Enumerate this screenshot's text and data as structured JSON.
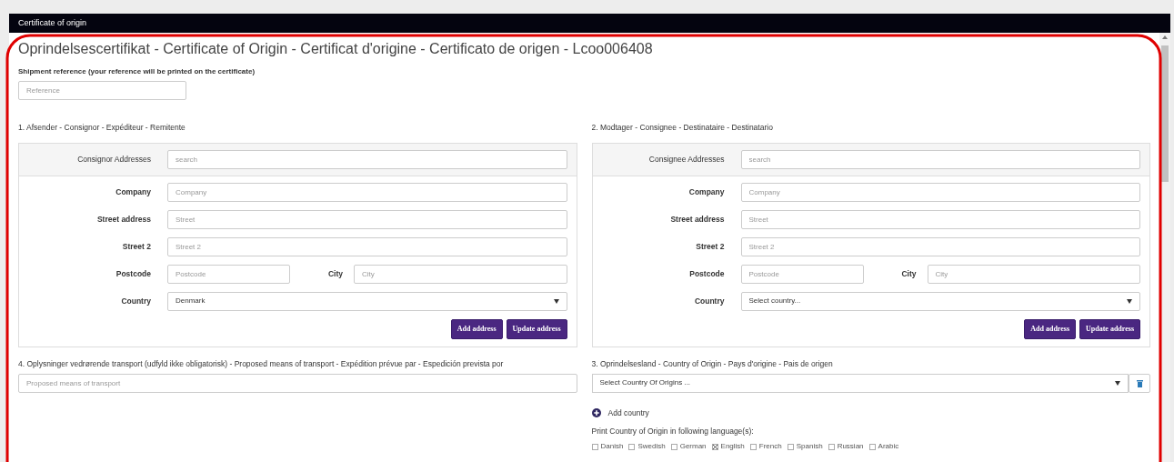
{
  "window": {
    "title": "Certificate of origin"
  },
  "heading": "Oprindelsescertifikat - Certificate of Origin - Certificat d'origine - Certificato de origen - Lcoo006408",
  "shipment_reference": {
    "label": "Shipment reference (your reference will be printed on the certificate)",
    "placeholder": "Reference"
  },
  "parties": [
    {
      "title": "1. Afsender - Consignor - Expéditeur - Remitente",
      "search": {
        "label": "Consignor Addresses",
        "placeholder": "search"
      },
      "fields": [
        {
          "kind": "text",
          "label": "Company",
          "placeholder": "Company"
        },
        {
          "kind": "text",
          "label": "Street address",
          "placeholder": "Street"
        },
        {
          "kind": "text",
          "label": "Street 2",
          "placeholder": "Street 2"
        },
        {
          "kind": "pair",
          "label": "Postcode",
          "placeholder": "Postcode",
          "label2": "City",
          "placeholder2": "City"
        },
        {
          "kind": "select",
          "label": "Country",
          "value": "Denmark"
        }
      ],
      "buttons": [
        "Add address",
        "Update address"
      ]
    },
    {
      "title": "2. Modtager - Consignee - Destinataire - Destinatario",
      "search": {
        "label": "Consignee Addresses",
        "placeholder": "search"
      },
      "fields": [
        {
          "kind": "text",
          "label": "Company",
          "placeholder": "Company"
        },
        {
          "kind": "text",
          "label": "Street address",
          "placeholder": "Street"
        },
        {
          "kind": "text",
          "label": "Street 2",
          "placeholder": "Street 2"
        },
        {
          "kind": "pair",
          "label": "Postcode",
          "placeholder": "Postcode",
          "label2": "City",
          "placeholder2": "City"
        },
        {
          "kind": "select",
          "label": "Country",
          "value": "Select country..."
        }
      ],
      "buttons": [
        "Add address",
        "Update address"
      ]
    }
  ],
  "transport": {
    "title": "4. Oplysninger vedrørende transport (udfyld ikke obligatorisk) - Proposed means of transport - Expédition prévue par - Espedición prevista por",
    "placeholder": "Proposed means of transport"
  },
  "origin": {
    "title": "3. Oprindelsesland - Country of Origin - Pays d'origine - Pais de origen",
    "select_value": "Select Country Of Origins ...",
    "add_link": "Add country",
    "languages_label": "Print Country of Origin in following language(s):",
    "languages": [
      {
        "label": "Danish",
        "checked": false
      },
      {
        "label": "Swedish",
        "checked": false
      },
      {
        "label": "German",
        "checked": false
      },
      {
        "label": "English",
        "checked": true
      },
      {
        "label": "French",
        "checked": false
      },
      {
        "label": "Spanish",
        "checked": false
      },
      {
        "label": "Russian",
        "checked": false
      },
      {
        "label": "Arabic",
        "checked": false
      }
    ]
  }
}
